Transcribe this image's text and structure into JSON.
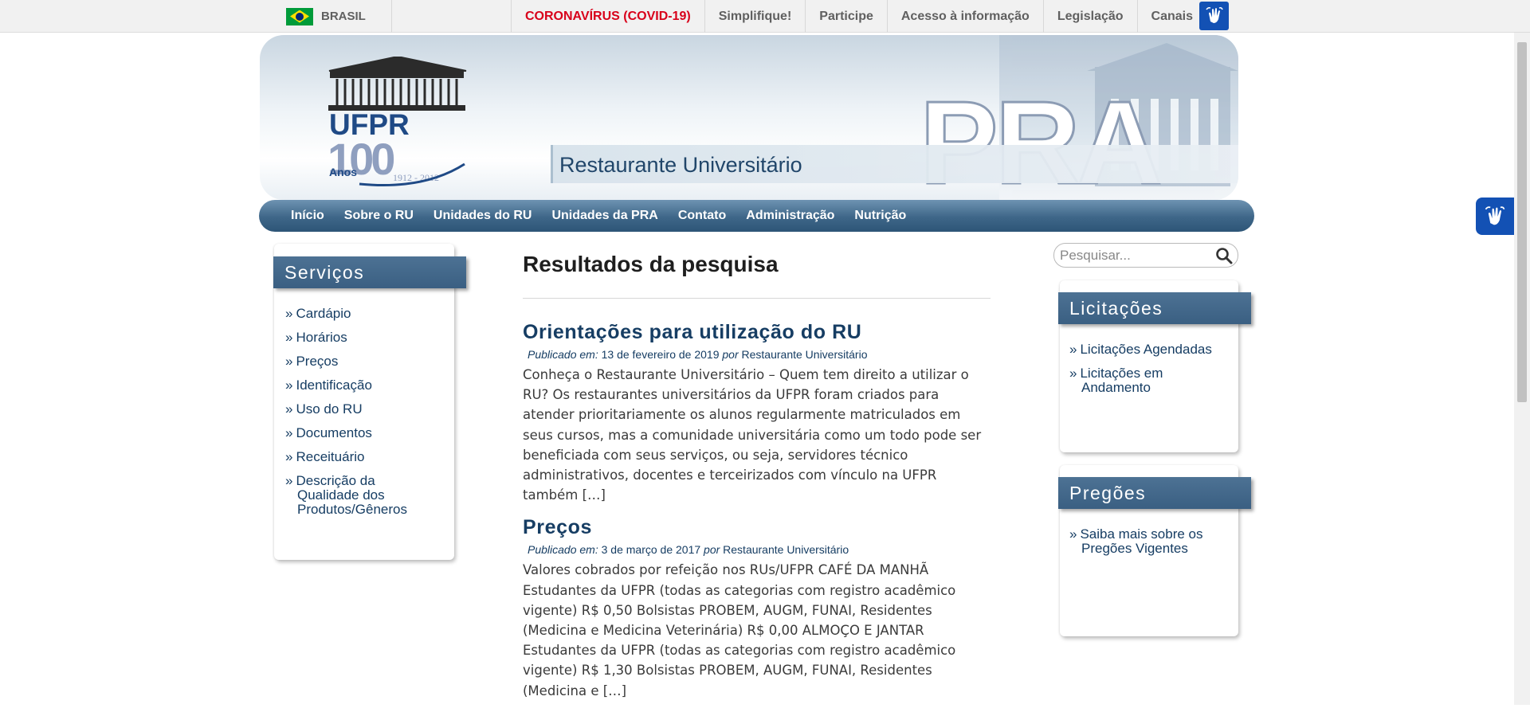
{
  "govbar": {
    "country": "BRASIL",
    "links": [
      {
        "label": "CORONAVÍRUS (COVID-19)"
      },
      {
        "label": "Simplifique!"
      },
      {
        "label": "Participe"
      },
      {
        "label": "Acesso à informação"
      },
      {
        "label": "Legislação"
      },
      {
        "label": "Canais"
      }
    ],
    "accessibility_icon": "sign-language-icon"
  },
  "header": {
    "logo_text": "UFPR",
    "logo_years": "100",
    "logo_anos": "Anos",
    "logo_range": "1912 - 2012",
    "pra": "PRA",
    "site_title": "Restaurante Universitário"
  },
  "nav": {
    "items": [
      {
        "label": "Início"
      },
      {
        "label": "Sobre o RU"
      },
      {
        "label": "Unidades do RU"
      },
      {
        "label": "Unidades da PRA"
      },
      {
        "label": "Contato"
      },
      {
        "label": "Administração"
      },
      {
        "label": "Nutrição"
      }
    ]
  },
  "services": {
    "title": "Serviços",
    "items": [
      {
        "label": "Cardápio"
      },
      {
        "label": "Horários"
      },
      {
        "label": "Preços"
      },
      {
        "label": "Identificação"
      },
      {
        "label": "Uso do RU"
      },
      {
        "label": "Documentos"
      },
      {
        "label": "Receituário"
      },
      {
        "label": "Descrição da Qualidade dos Produtos/Gêneros"
      }
    ]
  },
  "main": {
    "heading": "Resultados da pesquisa",
    "results": [
      {
        "title": "Orientações para utilização do RU",
        "published_label": "Publicado em:",
        "date": "13 de fevereiro de 2019",
        "by_label": "por",
        "author": "Restaurante Universitário",
        "excerpt": "Conheça o Restaurante Universitário  – Quem tem direito a utilizar o RU? Os restaurantes universitários da UFPR foram criados para atender prioritariamente os alunos regularmente matriculados em seus cursos, mas a comunidade universitária como um todo pode ser beneficiada com seus serviços, ou seja, servidores técnico administrativos, docentes e terceirizados com vínculo na UFPR também […]"
      },
      {
        "title": "Preços",
        "published_label": "Publicado em:",
        "date": "3 de março de 2017",
        "by_label": "por",
        "author": "Restaurante Universitário",
        "excerpt": "Valores cobrados por refeição nos RUs/UFPR   CAFÉ DA MANHÃ Estudantes da UFPR (todas as categorias com registro acadêmico vigente) R$ 0,50 Bolsistas PROBEM, AUGM, FUNAI, Residentes (Medicina e Medicina Veterinária) R$ 0,00 ALMOÇO E JANTAR Estudantes da UFPR (todas as categorias com registro acadêmico vigente) R$ 1,30 Bolsistas PROBEM, AUGM, FUNAI, Residentes (Medicina e […]"
      }
    ]
  },
  "search": {
    "placeholder": "Pesquisar...",
    "icon": "search-icon"
  },
  "licitacoes": {
    "title": "Licitações",
    "items": [
      {
        "label": "Licitações Agendadas"
      },
      {
        "label": "Licitações em Andamento"
      }
    ]
  },
  "pregoes": {
    "title": "Pregões",
    "items": [
      {
        "label": "Saiba mais sobre os Pregões Vigentes"
      }
    ]
  },
  "colors": {
    "nav_blue": "#3e6688",
    "link_blue": "#163d63",
    "covid_red": "#d8001a",
    "gov_blue": "#1351b4"
  }
}
